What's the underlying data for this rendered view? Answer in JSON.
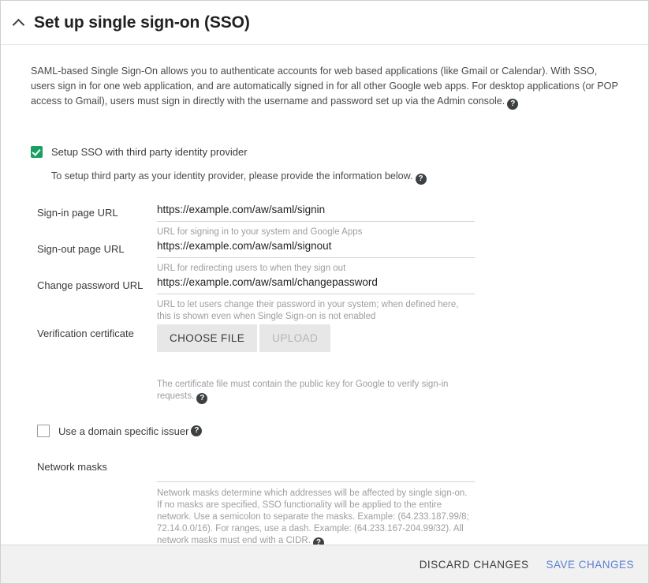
{
  "header": {
    "title": "Set up single sign-on (SSO)",
    "collapse_icon": "chevron-up-icon"
  },
  "intro": {
    "text": "SAML-based Single Sign-On allows you to authenticate accounts for web based applications (like Gmail or Calendar). With SSO, users sign in for one web application, and are automatically signed in for all other Google web apps. For desktop applications (or POP access to Gmail), users must sign in directly with the username and password set up via the Admin console.",
    "help_icon": "help-icon"
  },
  "sso_toggle": {
    "label": "Setup SSO with third party identity provider",
    "checked": true,
    "note": "To setup third party as your identity provider, please provide the information below.",
    "note_help_icon": "help-icon"
  },
  "fields": {
    "signin": {
      "label": "Sign-in page URL",
      "value": "https://example.com/aw/saml/signin",
      "placeholder": "",
      "hint": "URL for signing in to your system and Google Apps"
    },
    "signout": {
      "label": "Sign-out page URL",
      "value": "https://example.com/aw/saml/signout",
      "placeholder": "",
      "hint": "URL for redirecting users to when they sign out"
    },
    "change_password": {
      "label": "Change password URL",
      "value": "https://example.com/aw/saml/changepassword",
      "placeholder": "",
      "hint": "URL to let users change their password in your system; when defined here, this is shown even when Single Sign-on is not enabled"
    },
    "certificate": {
      "label": "Verification certificate",
      "choose_file_label": "CHOOSE FILE",
      "upload_label": "UPLOAD",
      "upload_disabled": true,
      "hint": "The certificate file must contain the public key for Google to verify sign-in requests.",
      "hint_help_icon": "help-icon"
    },
    "domain_issuer": {
      "label": "Use a domain specific issuer",
      "checked": false,
      "help_icon": "help-icon"
    },
    "network_masks": {
      "label": "Network masks",
      "value": "",
      "placeholder": "",
      "hint": "Network masks determine which addresses will be affected by single sign-on. If no masks are specified, SSO functionality will be applied to the entire network. Use a semicolon to separate the masks. Example: (64.233.187.99/8; 72.14.0.0/16). For ranges, use a dash. Example: (64.233.167-204.99/32). All network masks must end with a CIDR.",
      "hint_help_icon": "help-icon"
    }
  },
  "footer": {
    "discard_label": "DISCARD CHANGES",
    "save_label": "SAVE CHANGES"
  },
  "colors": {
    "checkbox_green": "#17a05f",
    "save_blue": "#5b7fd4",
    "help_icon_dark": "#3c4043"
  }
}
